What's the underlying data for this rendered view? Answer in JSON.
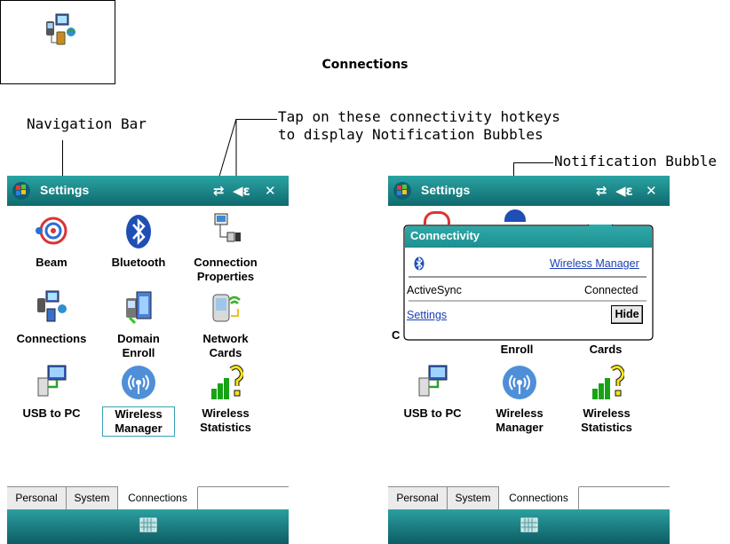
{
  "header_icon": {
    "label": "Connections"
  },
  "callouts": {
    "navigation_bar": "Navigation Bar",
    "hotkeys_line1": "Tap on these connectivity hotkeys",
    "hotkeys_line2": "to display Notification Bubbles",
    "notification_bubble": "Notification Bubble"
  },
  "left_screen": {
    "title": "Settings",
    "hotkeys": {
      "connectivity": "⇄",
      "volume": "◀ɛ",
      "close": "✕"
    },
    "icons": [
      {
        "label": "Beam",
        "icon": "beam-icon"
      },
      {
        "label": "Bluetooth",
        "icon": "bluetooth-icon"
      },
      {
        "label": "Connection\nProperties",
        "icon": "connection-properties-icon"
      },
      {
        "label": "Connections",
        "icon": "connections-icon"
      },
      {
        "label": "Domain\nEnroll",
        "icon": "domain-enroll-icon"
      },
      {
        "label": "Network\nCards",
        "icon": "network-cards-icon"
      },
      {
        "label": "USB to PC",
        "icon": "usb-to-pc-icon"
      },
      {
        "label": "Wireless\nManager",
        "icon": "wireless-manager-icon",
        "selected": true
      },
      {
        "label": "Wireless\nStatistics",
        "icon": "wireless-statistics-icon"
      }
    ],
    "tabs": [
      "Personal",
      "System",
      "Connections"
    ],
    "active_tab": "Connections"
  },
  "right_screen": {
    "title": "Settings",
    "visible_labels": [
      "Enroll",
      "Cards",
      "USB to PC",
      "Wireless\nManager",
      "Wireless\nStatistics"
    ],
    "tabs": [
      "Personal",
      "System",
      "Connections"
    ],
    "bubble": {
      "header": "Connectivity",
      "wireless_manager_link": "Wireless Manager",
      "activesync_label": "ActiveSync",
      "activesync_status": "Connected",
      "settings_link": "Settings",
      "hide_button": "Hide"
    }
  },
  "colors": {
    "titlebar": "#1a8a8e",
    "bubble_header": "#2aa3a3",
    "link": "#1a3fb5"
  }
}
